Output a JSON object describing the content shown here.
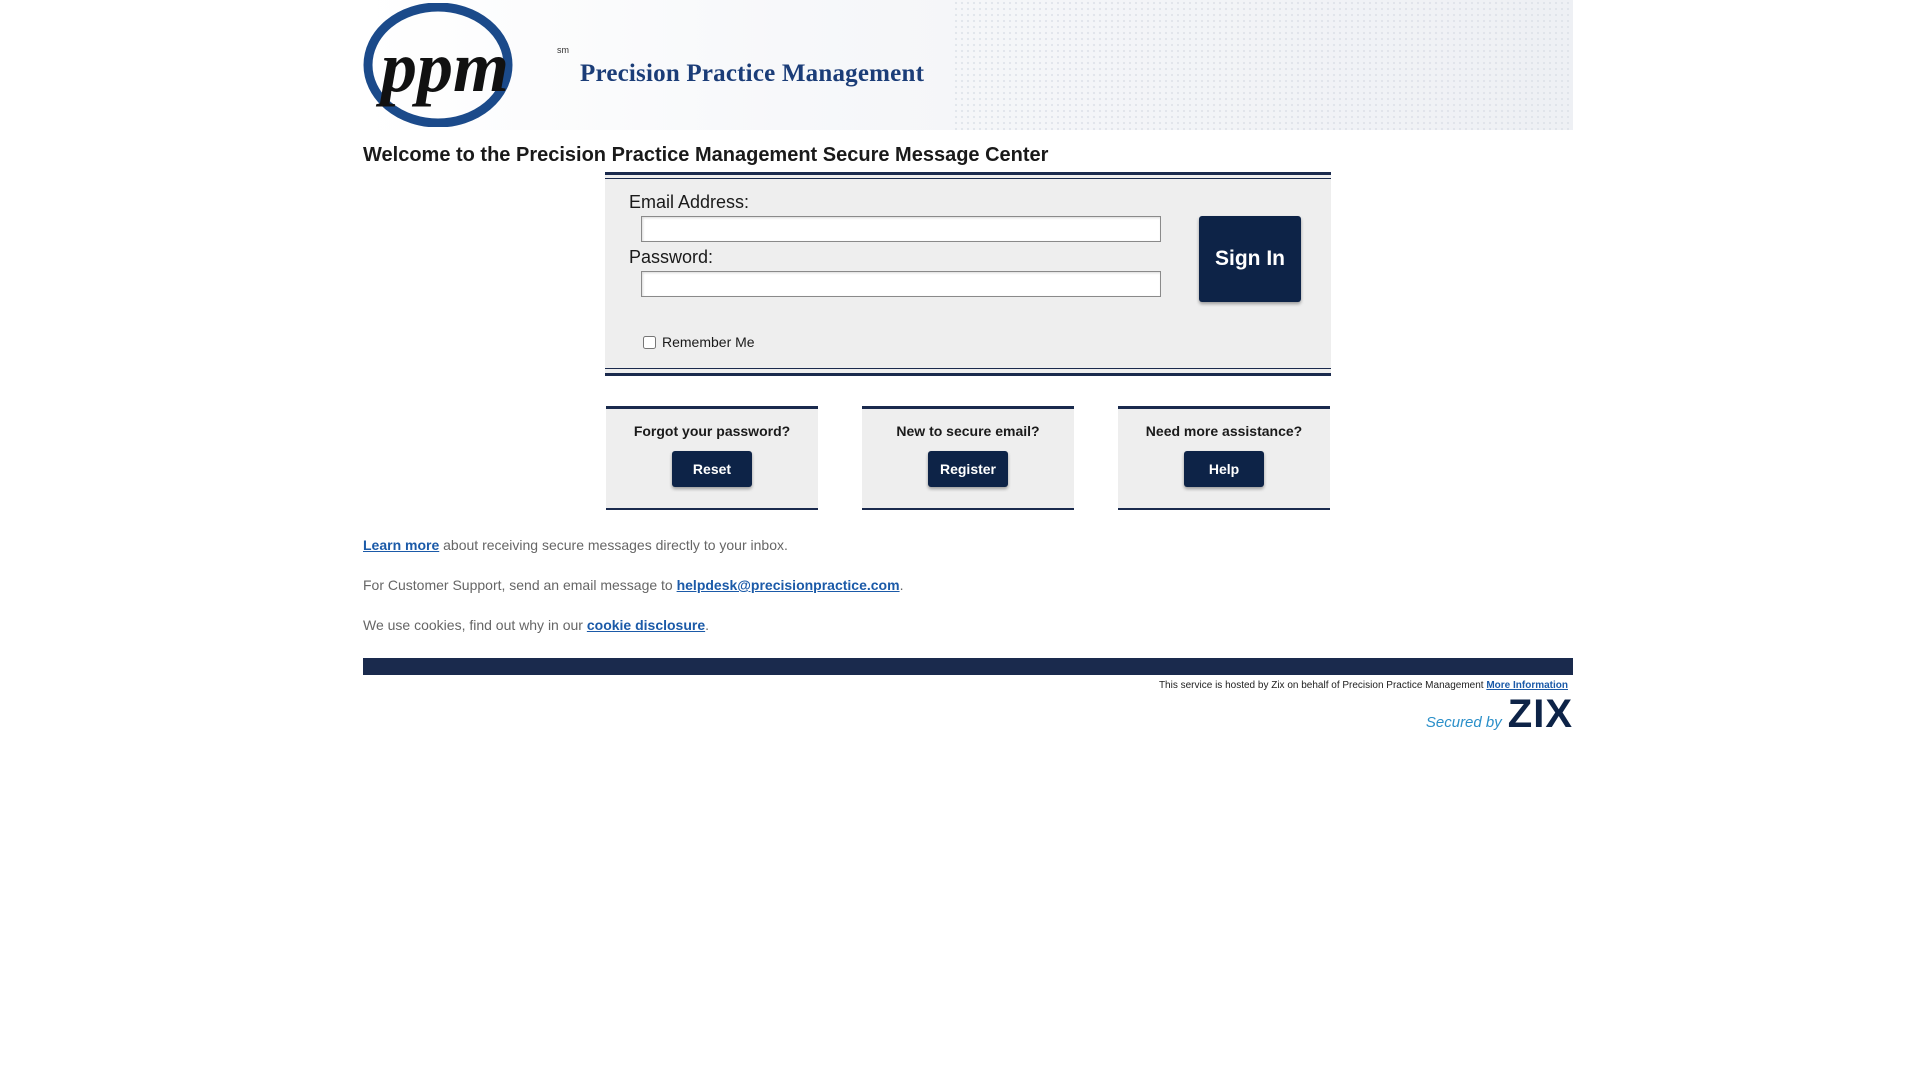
{
  "header": {
    "logo_text": "ppm",
    "logo_mark": "sm",
    "brand_name": "Precision Practice Management"
  },
  "page_title": "Welcome to the Precision Practice Management Secure Message Center",
  "login": {
    "email_label": "Email Address:",
    "email_value": "",
    "password_label": "Password:",
    "password_value": "",
    "signin_label": "Sign In",
    "remember_label": "Remember Me",
    "remember_checked": false
  },
  "boxes": [
    {
      "question": "Forgot your password?",
      "button": "Reset"
    },
    {
      "question": "New to secure email?",
      "button": "Register"
    },
    {
      "question": "Need more assistance?",
      "button": "Help"
    }
  ],
  "info": {
    "learn_link": "Learn more",
    "learn_text": " about receiving secure messages directly to your inbox.",
    "support_text": "For Customer Support, send an email message to ",
    "support_link": "helpdesk@precisionpractice.com",
    "support_end": ".",
    "cookie_text": "We use cookies, find out why in our ",
    "cookie_link": "cookie disclosure",
    "cookie_end": "."
  },
  "footer": {
    "hosted_text": "This service is hosted by Zix on behalf of Precision Practice Management ",
    "more_info_link": "More Information",
    "secured_by": "Secured by",
    "zix_word": "ZIX"
  },
  "colors": {
    "navy": "#0d2347",
    "rule": "#1a2a4d",
    "link": "#1b5aa8",
    "brand": "#1b3d78",
    "panel": "#eeeeee"
  }
}
